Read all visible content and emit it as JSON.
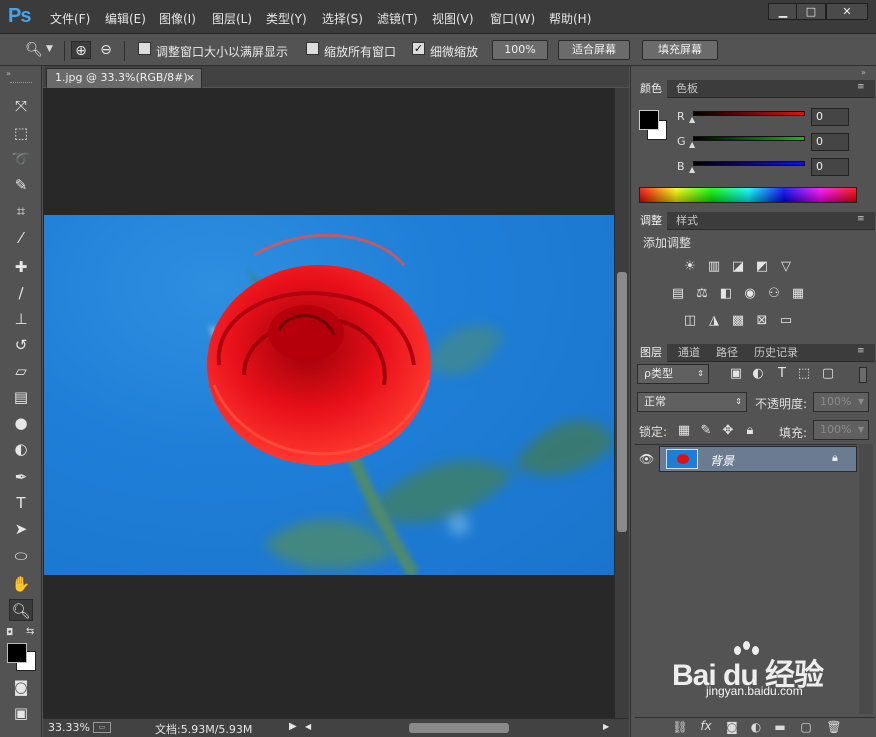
{
  "app": {
    "logo": "Ps"
  },
  "menu": {
    "items": [
      "文件(F)",
      "编辑(E)",
      "图像(I)",
      "图层(L)",
      "类型(Y)",
      "选择(S)",
      "滤镜(T)",
      "视图(V)",
      "窗口(W)",
      "帮助(H)"
    ]
  },
  "window_buttons": {
    "minimize": "▁",
    "restore": "□",
    "close": "✕"
  },
  "options": {
    "resize_windows_label": "调整窗口大小以满屏显示",
    "resize_windows_checked": false,
    "zoom_all_windows_label": "缩放所有窗口",
    "zoom_all_windows_checked": false,
    "scrubby_zoom_label": "细微缩放",
    "scrubby_zoom_checked": true,
    "actual_pixels_button": "100%",
    "fit_screen_button": "适合屏幕",
    "fill_screen_button": "填充屏幕"
  },
  "document": {
    "tab_title": "1.jpg @ 33.3%(RGB/8#)",
    "tab_close": "×"
  },
  "status": {
    "zoom": "33.33%",
    "doc_info": "文档:5.93M/5.93M"
  },
  "color_panel": {
    "tabs": [
      "颜色",
      "色板"
    ],
    "channels": [
      {
        "label": "R",
        "value": "0",
        "color": "#e01010"
      },
      {
        "label": "G",
        "value": "0",
        "color": "#10c010"
      },
      {
        "label": "B",
        "value": "0",
        "color": "#1010e0"
      }
    ]
  },
  "adjustments_panel": {
    "tabs": [
      "调整",
      "样式"
    ],
    "title": "添加调整"
  },
  "layers_panel": {
    "tabs": [
      "图层",
      "通道",
      "路径",
      "历史记录"
    ],
    "filter_label": "ρ类型",
    "blend_mode": "正常",
    "opacity_label": "不透明度:",
    "opacity_value": "100%",
    "lock_label": "锁定:",
    "fill_label": "填充:",
    "fill_value": "100%",
    "layers": [
      {
        "name": "背景",
        "visible": true,
        "locked": true
      }
    ]
  },
  "watermark": {
    "brand": "Bai du 经验",
    "url": "jingyan.baidu.com"
  },
  "colors": {
    "accent": "#4aa3e8",
    "canvas_bg": "#282828",
    "panel_bg": "#535353"
  }
}
